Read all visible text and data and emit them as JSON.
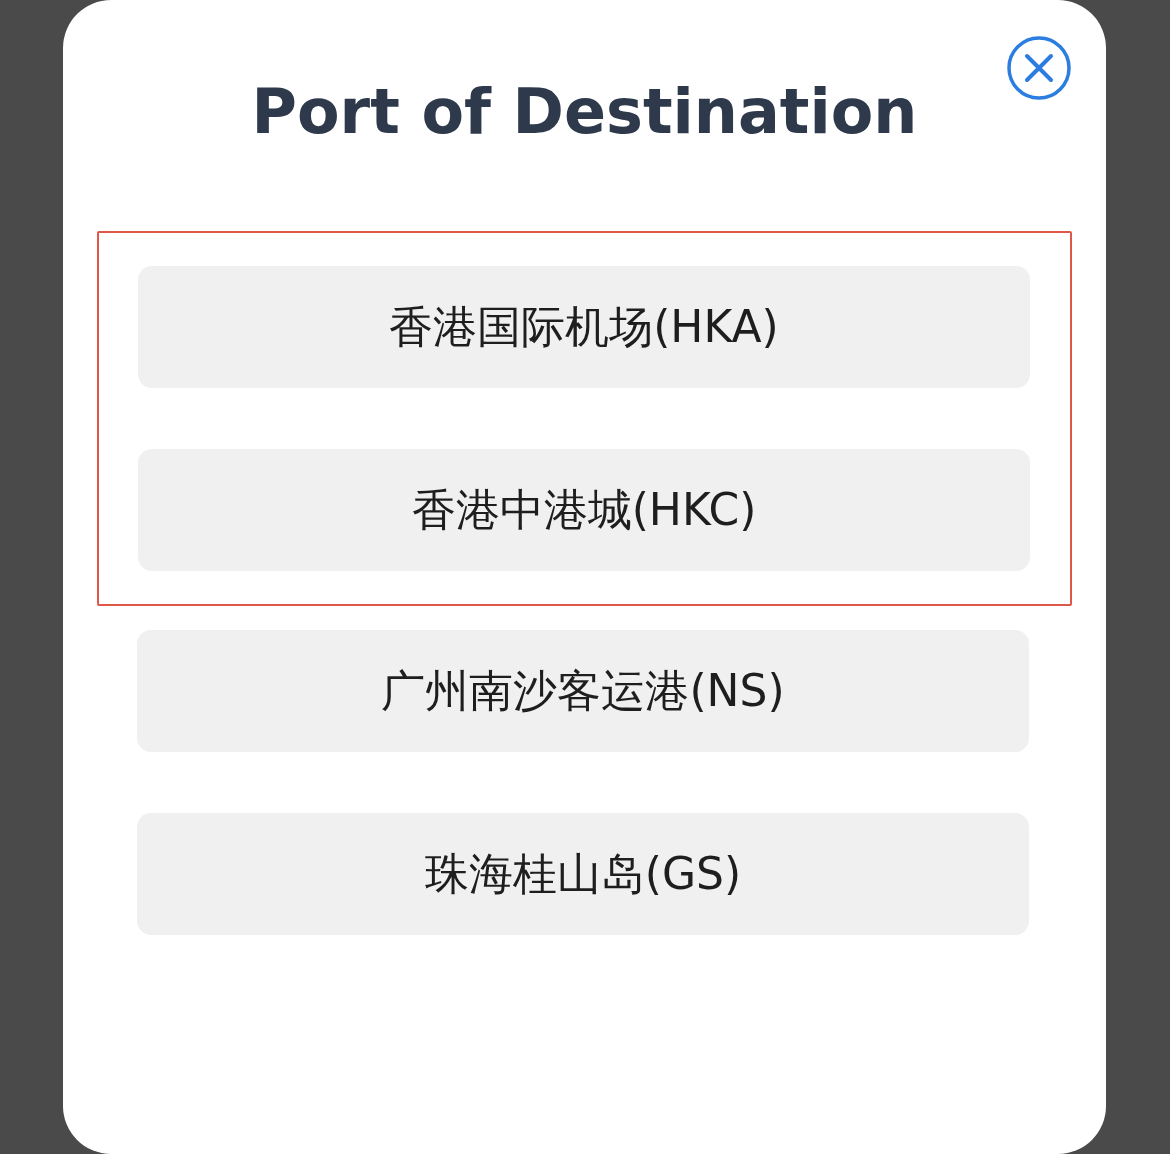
{
  "dialog": {
    "title": "Port of Destination",
    "groups": [
      {
        "highlighted": true,
        "options": [
          {
            "label": "香港国际机场(HKA)"
          },
          {
            "label": "香港中港城(HKC)"
          }
        ]
      },
      {
        "highlighted": false,
        "options": [
          {
            "label": "广州南沙客运港(NS)"
          },
          {
            "label": "珠海桂山岛(GS)"
          }
        ]
      }
    ]
  }
}
